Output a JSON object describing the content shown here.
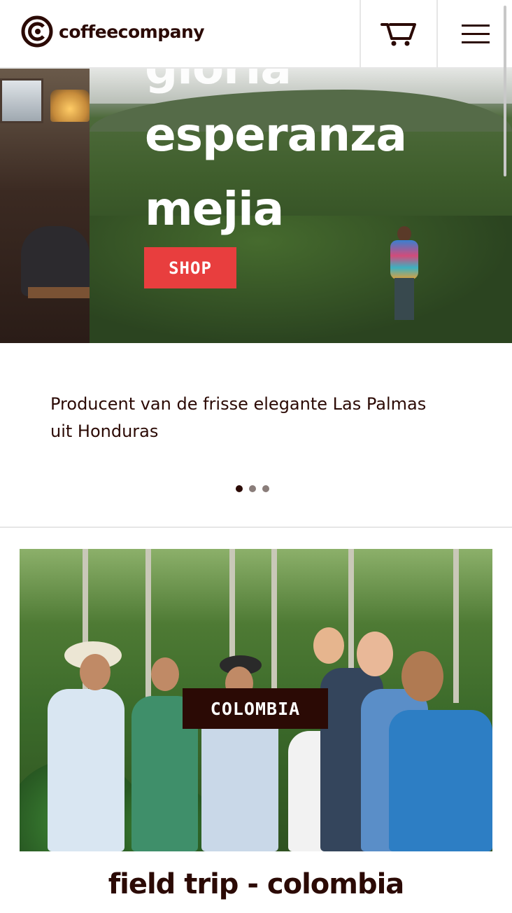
{
  "header": {
    "brand": "coffeecompany",
    "cart_icon": "cart-icon",
    "menu_icon": "hamburger-menu-icon",
    "brand_color": "#2b0a05"
  },
  "hero": {
    "title_lines": [
      "gloria",
      "esperanza",
      "mejia"
    ],
    "shop_label": "SHOP",
    "shop_color": "#e83e3e"
  },
  "intro": {
    "text": "Producent van de frisse elegante Las Palmas uit Honduras"
  },
  "carousel": {
    "slides": 3,
    "active": 1
  },
  "card": {
    "badge": "COLOMBIA",
    "title": "field trip - colombia"
  }
}
